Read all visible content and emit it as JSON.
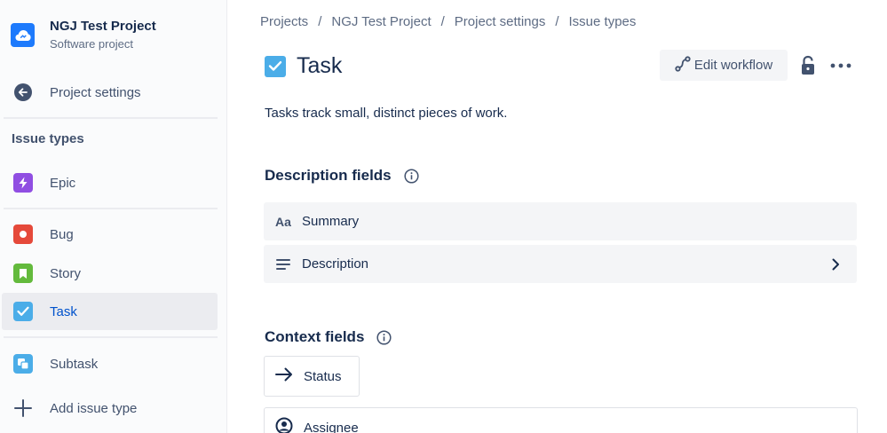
{
  "project": {
    "name": "NGJ Test Project",
    "type": "Software project"
  },
  "sidebar": {
    "back_label": "Project settings",
    "section_label": "Issue types",
    "items": [
      {
        "label": "Epic",
        "icon": "lightning-icon",
        "color": "#904ee2"
      },
      {
        "label": "Bug",
        "icon": "bug-icon",
        "color": "#e5493a"
      },
      {
        "label": "Story",
        "icon": "bookmark-icon",
        "color": "#63ba3c"
      },
      {
        "label": "Task",
        "icon": "checkbox-icon",
        "color": "#4bade8",
        "active": true
      },
      {
        "label": "Subtask",
        "icon": "subtask-icon",
        "color": "#4bade8"
      }
    ],
    "add_label": "Add issue type"
  },
  "breadcrumbs": [
    "Projects",
    "NGJ Test Project",
    "Project settings",
    "Issue types"
  ],
  "breadcrumb_separator": "/",
  "header": {
    "title": "Task",
    "edit_workflow_label": "Edit workflow"
  },
  "description": "Tasks track small, distinct pieces of work.",
  "description_fields": {
    "heading": "Description fields",
    "fields": [
      {
        "label": "Summary",
        "icon_text": "Aa"
      },
      {
        "label": "Description",
        "icon": "lines-icon"
      }
    ]
  },
  "context_fields": {
    "heading": "Context fields",
    "fields": [
      {
        "label": "Status",
        "icon": "arrow-right-icon"
      },
      {
        "label": "Assignee",
        "icon": "user-icon"
      }
    ]
  },
  "colors": {
    "accent": "#0052cc",
    "task": "#4bade8",
    "project_avatar": "#1d7afc"
  }
}
